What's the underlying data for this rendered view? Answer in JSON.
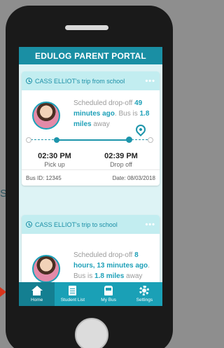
{
  "background": {
    "partial_text": "S."
  },
  "header": {
    "title": "EDULOG PARENT PORTAL"
  },
  "trips": [
    {
      "title": "CASS ELLIOT's trip from school",
      "more": "•••",
      "sched_pre": "Scheduled drop-off ",
      "sched_time": "49 minutes ago",
      "sched_mid": ". Bus is ",
      "sched_dist": "1.8 miles",
      "sched_post": " away",
      "pickup_time": "02:30 PM",
      "pickup_label": "Pick up",
      "dropoff_time": "02:39 PM",
      "dropoff_label": "Drop off",
      "bus_id": "Bus ID: 12345",
      "date": "Date: 08/03/2018"
    },
    {
      "title": "CASS ELLIOT's trip to school",
      "more": "•••",
      "sched_pre": "Scheduled drop-off ",
      "sched_time": "8 hours, 13 minutes ago",
      "sched_mid": ". Bus is ",
      "sched_dist": "1.8 miles",
      "sched_post": " away"
    }
  ],
  "tabs": [
    {
      "label": "Home",
      "icon": "home-icon"
    },
    {
      "label": "Student List",
      "icon": "list-icon"
    },
    {
      "label": "My Bus",
      "icon": "bus-icon"
    },
    {
      "label": "Settings",
      "icon": "gear-icon"
    }
  ],
  "colors": {
    "accent": "#1aa0b6",
    "header": "#1a8fa4",
    "card_head": "#c2edf0",
    "screen_bg": "#ddf3f5"
  }
}
